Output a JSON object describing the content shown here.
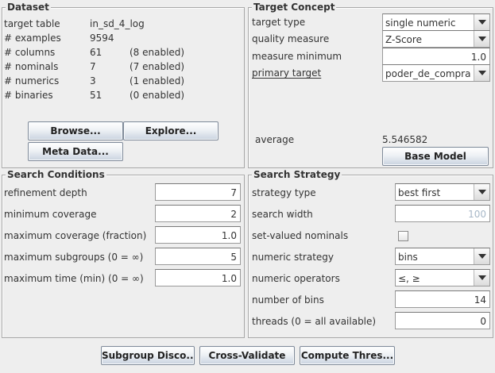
{
  "dataset": {
    "title": "Dataset",
    "rows": [
      {
        "label": "target table",
        "value": "in_sd_4_log",
        "extra": ""
      },
      {
        "label": "# examples",
        "value": "9594",
        "extra": ""
      },
      {
        "label": "# columns",
        "value": "61",
        "extra": "(8 enabled)"
      },
      {
        "label": "# nominals",
        "value": "7",
        "extra": "(7 enabled)"
      },
      {
        "label": "# numerics",
        "value": "3",
        "extra": "(1 enabled)"
      },
      {
        "label": "# binaries",
        "value": "51",
        "extra": "(0 enabled)"
      }
    ],
    "browse_label": "Browse...",
    "explore_label": "Explore...",
    "metadata_label": "Meta Data..."
  },
  "target_concept": {
    "title": "Target Concept",
    "target_type_label": "target type",
    "target_type_value": "single numeric",
    "quality_measure_label": "quality measure",
    "quality_measure_value": "Z-Score",
    "measure_minimum_label": "measure minimum",
    "measure_minimum_value": "1.0",
    "primary_target_label": "primary target",
    "primary_target_value": "poder_de_compra",
    "average_label": "average",
    "average_value": "5.546582",
    "base_model_label": "Base Model"
  },
  "search_conditions": {
    "title": "Search Conditions",
    "rows": [
      {
        "label": "refinement depth",
        "value": "7"
      },
      {
        "label": "minimum coverage",
        "value": "2"
      },
      {
        "label": "maximum coverage (fraction)",
        "value": "1.0"
      },
      {
        "label": "maximum subgroups (0 = ∞)",
        "value": "5"
      },
      {
        "label": "maximum time (min) (0 = ∞)",
        "value": "1.0"
      }
    ]
  },
  "search_strategy": {
    "title": "Search Strategy",
    "strategy_type_label": "strategy type",
    "strategy_type_value": "best first",
    "search_width_label": "search width",
    "search_width_value": "100",
    "set_valued_label": "set-valued nominals",
    "numeric_strategy_label": "numeric strategy",
    "numeric_strategy_value": "bins",
    "numeric_operators_label": "numeric operators",
    "numeric_operators_value": "≤, ≥",
    "number_of_bins_label": "number of bins",
    "number_of_bins_value": "14",
    "threads_label": "threads (0 = all available)",
    "threads_value": "0"
  },
  "actions": {
    "subgroup_label": "Subgroup Disco...",
    "cross_validate_label": "Cross-Validate",
    "compute_thresholds_label": "Compute Thres..."
  },
  "icons": {
    "dropdown": "chevron-down-icon"
  }
}
